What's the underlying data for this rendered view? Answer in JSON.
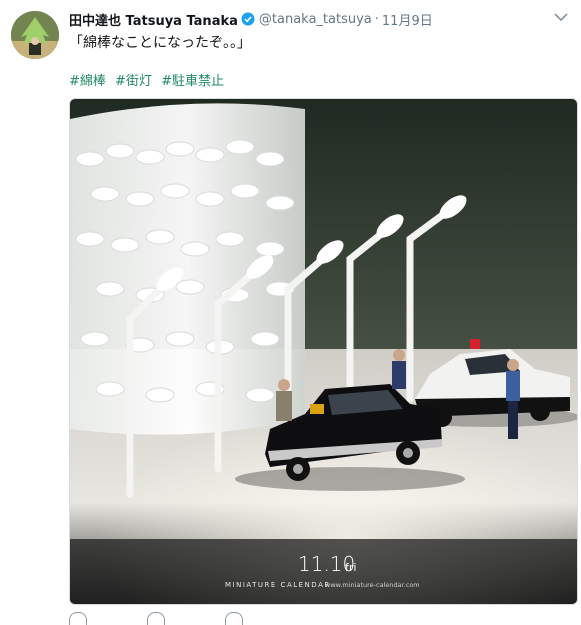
{
  "tweet": {
    "display_name": "田中達也 Tatsuya Tanaka",
    "handle": "@tanaka_tatsuya",
    "separator": "·",
    "date": "11月9日",
    "text": "「綿棒なことになったぞ。。」",
    "hashtags": [
      "#綿棒",
      "#街灯",
      "#駐車禁止"
    ]
  },
  "photo": {
    "date_label": "11.10",
    "day_label": "fri",
    "brand": "MINIATURE CALENDAR",
    "url": "www.miniature-calendar.com"
  },
  "colors": {
    "hashtag": "#1f8a61",
    "verified": "#1da1f2",
    "meta_gray": "#657786"
  },
  "icons": {
    "verified": "verified-badge-icon",
    "menu": "chevron-down-icon"
  }
}
